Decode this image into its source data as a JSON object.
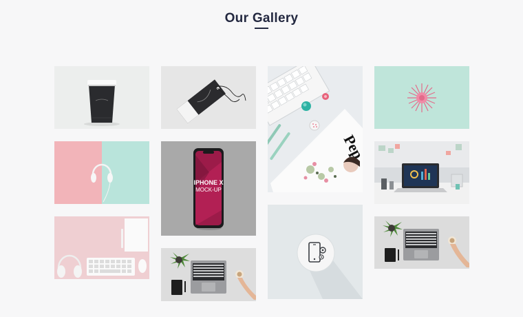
{
  "gallery": {
    "title": "Our Gallery",
    "items": [
      {
        "subject": "coffee cup mockup"
      },
      {
        "subject": "hang tag mockup"
      },
      {
        "subject": "keyboard, pins and magazine flatlay",
        "magazine_text": "Pep"
      },
      {
        "subject": "pink dandelion on mint background"
      },
      {
        "subject": "headphones on pink and mint background"
      },
      {
        "subject": "iPhone X mockup",
        "phone_line1": "IPHONE X",
        "phone_line2": "MOCK-UP"
      },
      {
        "subject": "laptop on office desk"
      },
      {
        "subject": "phone settings icon"
      },
      {
        "subject": "headphones, keyboard, mouse and notebook on pink"
      },
      {
        "subject": "laptop with plant and coffee"
      },
      {
        "subject": "laptop with plant and coffee"
      }
    ]
  },
  "colors": {
    "background": "#f7f7f8",
    "title": "#232840"
  }
}
